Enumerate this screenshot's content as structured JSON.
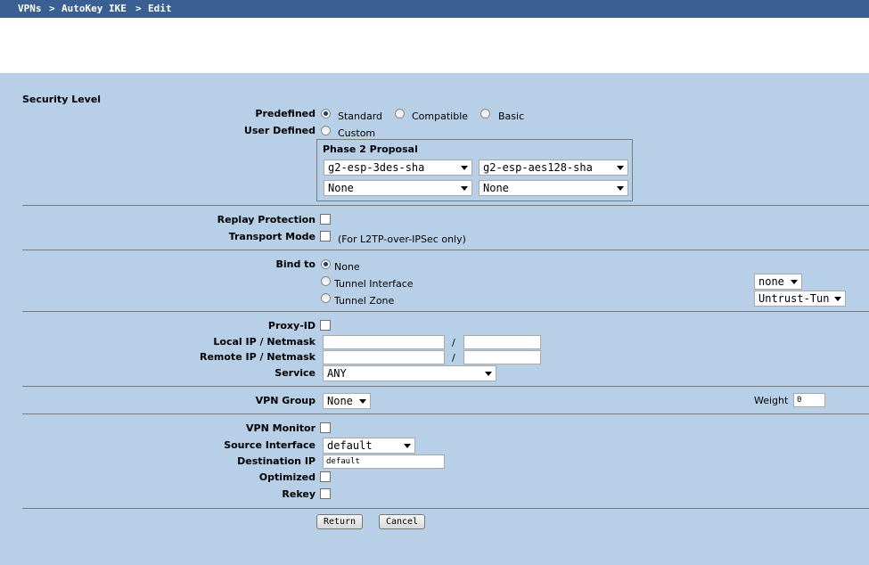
{
  "breadcrumb": {
    "part1": "VPNs",
    "part2": "AutoKey IKE",
    "part3": "Edit",
    "sep": ">"
  },
  "security": {
    "section_title": "Security Level",
    "predefined_label": "Predefined",
    "user_defined_label": "User Defined",
    "options": {
      "standard": "Standard",
      "compatible": "Compatible",
      "basic": "Basic",
      "custom": "Custom"
    },
    "selected": "Standard",
    "phase2_title": "Phase 2 Proposal",
    "proposals": [
      "g2-esp-3des-sha",
      "g2-esp-aes128-sha",
      "None",
      "None"
    ]
  },
  "replay_label": "Replay Protection",
  "transport_label": "Transport Mode",
  "transport_note": "(For L2TP-over-IPSec only)",
  "bind": {
    "label": "Bind to",
    "options": {
      "none": "None",
      "tunnel_interface": "Tunnel Interface",
      "tunnel_zone": "Tunnel Zone"
    },
    "selected": "None",
    "interface_value": "none",
    "zone_value": "Untrust-Tun"
  },
  "proxy": {
    "label": "Proxy-ID",
    "local_label": "Local IP / Netmask",
    "remote_label": "Remote IP / Netmask",
    "slash": "/",
    "service_label": "Service",
    "service_value": "ANY"
  },
  "vpn_group": {
    "label": "VPN Group",
    "value": "None",
    "weight_label": "Weight",
    "weight_value": "0"
  },
  "monitor": {
    "label": "VPN Monitor",
    "source_label": "Source Interface",
    "source_value": "default",
    "dest_label": "Destination IP",
    "dest_value": "default",
    "optimized_label": "Optimized",
    "rekey_label": "Rekey"
  },
  "buttons": {
    "return": "Return",
    "cancel": "Cancel"
  }
}
